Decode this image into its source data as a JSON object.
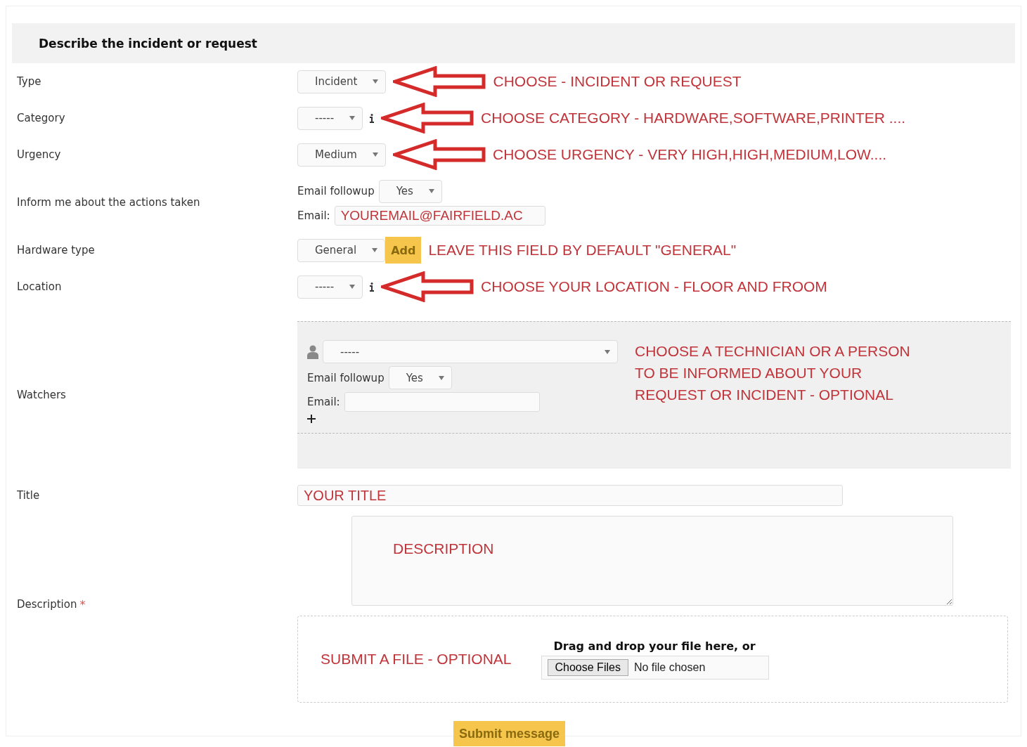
{
  "form": {
    "title": "Describe the incident or request"
  },
  "rows": [
    {
      "kind": "select",
      "label": "Type",
      "value": "Incident",
      "info": false,
      "note": "CHOOSE - INCIDENT OR REQUEST"
    },
    {
      "kind": "select",
      "label": "Category",
      "value": "-----",
      "info": true,
      "note": "CHOOSE CATEGORY - HARDWARE,SOFTWARE,PRINTER ...."
    },
    {
      "kind": "select",
      "label": "Urgency",
      "value": "Medium",
      "info": false,
      "note": "CHOOSE URGENCY - VERY HIGH,HIGH,MEDIUM,LOW...."
    },
    {
      "kind": "followup",
      "label": "Inform me about the actions taken",
      "followup_label": "Email followup",
      "followup_value": "Yes",
      "email_label": "Email:",
      "email_value": "YOUREMAIL@FAIRFIELD.AC"
    },
    {
      "kind": "hardware",
      "label": "Hardware type",
      "value": "General",
      "add_button": "Add",
      "note": "LEAVE THIS FIELD  BY DEFAULT \"GENERAL\""
    },
    {
      "kind": "select",
      "label": "Location",
      "value": "-----",
      "info": true,
      "note": "CHOOSE YOUR LOCATION - FLOOR AND FROOM"
    },
    {
      "kind": "watchers",
      "label": "Watchers",
      "person_value": "-----",
      "followup_label": "Email followup",
      "followup_value": "Yes",
      "email_label": "Email:",
      "note_lines": [
        "CHOOSE A TECHNICIAN OR A PERSON",
        "TO BE INFORMED ABOUT YOUR",
        "REQUEST OR INCIDENT - OPTIONAL"
      ]
    },
    {
      "kind": "title",
      "label": "Title",
      "value": "YOUR TITLE"
    },
    {
      "kind": "description",
      "label": "Description",
      "required_mark": "*",
      "value": "DESCRIPTION",
      "file_note": "SUBMIT A FILE - OPTIONAL",
      "drop_text": "Drag and drop your file here, or",
      "choose_button": "Choose Files",
      "file_status": "No file chosen"
    }
  ],
  "submit": "Submit message"
}
